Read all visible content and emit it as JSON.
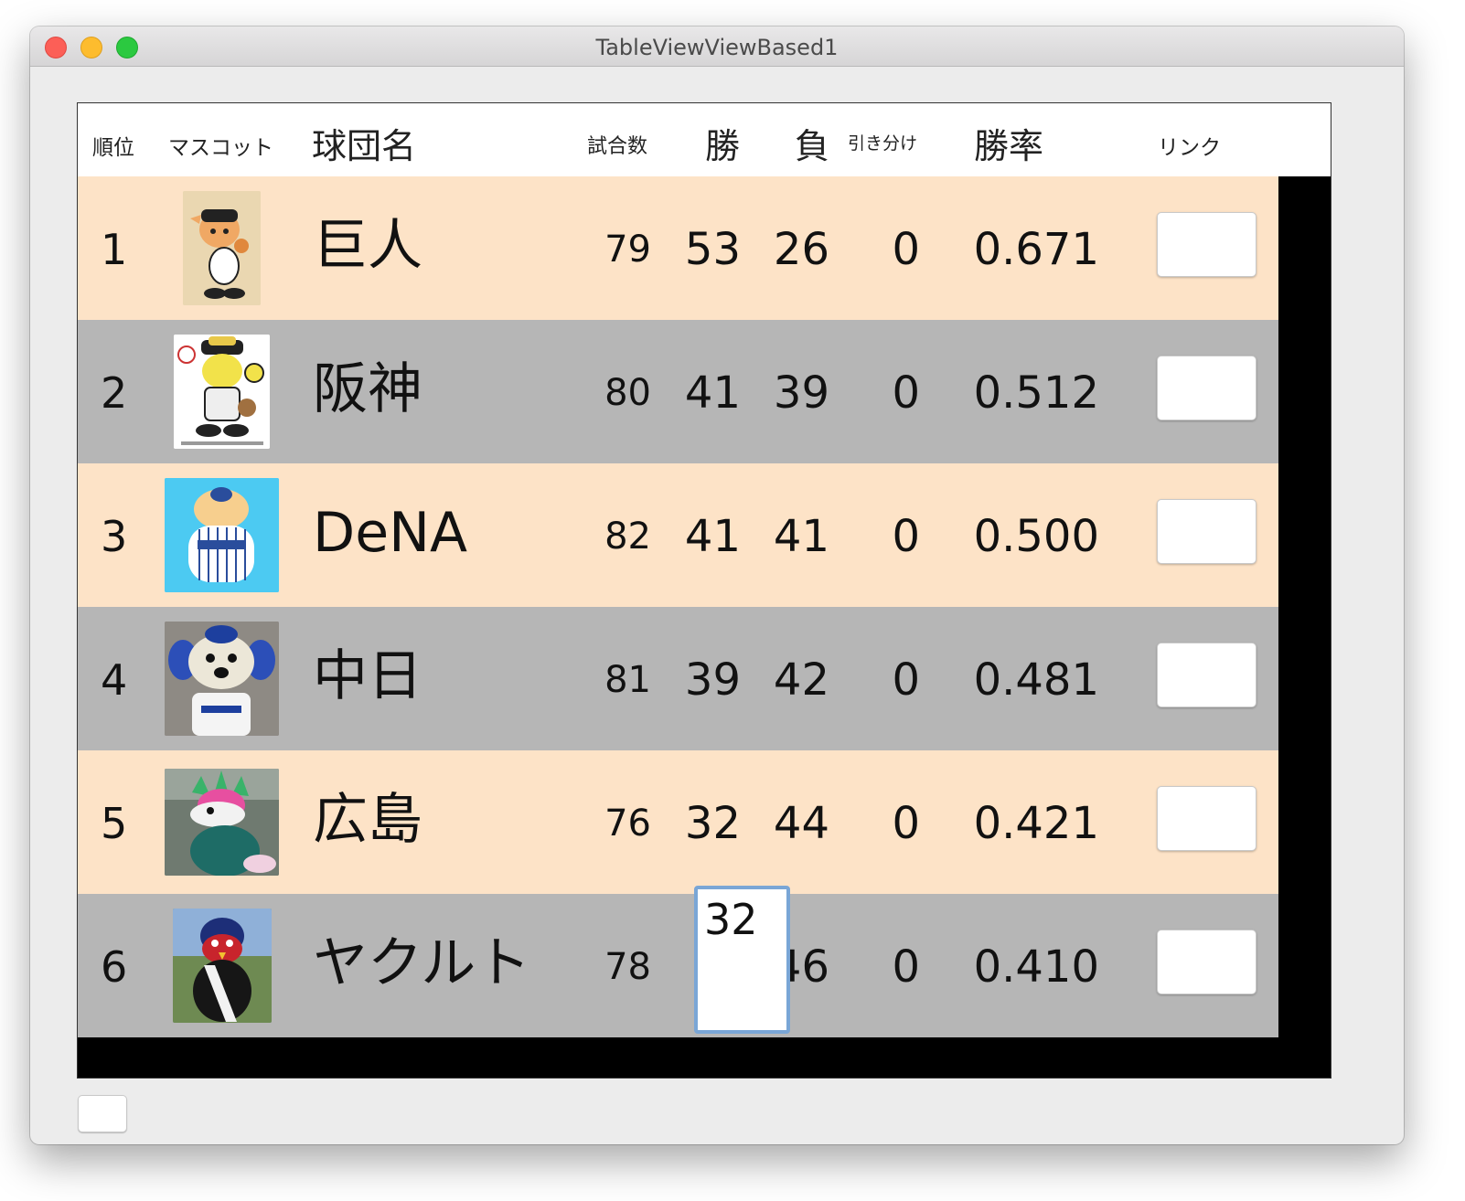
{
  "window": {
    "title": "TableViewViewBased1"
  },
  "headers": {
    "rank": "順位",
    "mascot": "マスコット",
    "team": "球団名",
    "games": "試合数",
    "wins": "勝",
    "losses": "負",
    "draws": "引き分け",
    "pct": "勝率",
    "link": "リンク"
  },
  "rows": [
    {
      "rank": "1",
      "team": "巨人",
      "games": "79",
      "wins": "53",
      "losses": "26",
      "draws": "0",
      "pct": "0.671",
      "mascot_icon": "giants-mascot-icon"
    },
    {
      "rank": "2",
      "team": "阪神",
      "games": "80",
      "wins": "41",
      "losses": "39",
      "draws": "0",
      "pct": "0.512",
      "mascot_icon": "tigers-mascot-icon"
    },
    {
      "rank": "3",
      "team": "DeNA",
      "games": "82",
      "wins": "41",
      "losses": "41",
      "draws": "0",
      "pct": "0.500",
      "mascot_icon": "baystars-mascot-icon"
    },
    {
      "rank": "4",
      "team": "中日",
      "games": "81",
      "wins": "39",
      "losses": "42",
      "draws": "0",
      "pct": "0.481",
      "mascot_icon": "dragons-mascot-icon"
    },
    {
      "rank": "5",
      "team": "広島",
      "games": "76",
      "wins": "32",
      "losses": "44",
      "draws": "0",
      "pct": "0.421",
      "mascot_icon": "carp-mascot-icon"
    },
    {
      "rank": "6",
      "team": "ヤクルト",
      "games": "78",
      "wins": "",
      "losses": "46",
      "draws": "0",
      "pct": "0.410",
      "mascot_icon": "swallows-mascot-icon"
    }
  ],
  "editing": {
    "value": "32"
  },
  "colors": {
    "row_even": "#fde3c7",
    "row_odd": "#b6b6b6",
    "focus": "#7aa6d6",
    "table_bg": "#000000"
  }
}
